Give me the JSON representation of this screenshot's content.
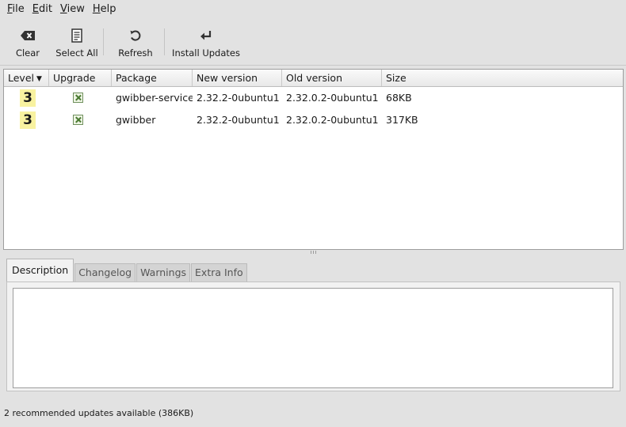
{
  "menu": [
    {
      "mnemonic": "F",
      "rest": "ile"
    },
    {
      "mnemonic": "E",
      "rest": "dit"
    },
    {
      "mnemonic": "V",
      "rest": "iew"
    },
    {
      "mnemonic": "H",
      "rest": "elp"
    }
  ],
  "toolbar": {
    "clear_label": "Clear",
    "select_all_label": "Select All",
    "refresh_label": "Refresh",
    "install_label": "Install Updates",
    "clear_icon": "backspace-icon",
    "select_all_icon": "document-list-icon",
    "refresh_icon": "refresh-icon",
    "install_icon": "enter-arrow-icon"
  },
  "table": {
    "columns": [
      "Level",
      "Upgrade",
      "Package",
      "New version",
      "Old version",
      "Size"
    ],
    "sort_indicator": "▼",
    "rows": [
      {
        "level": "3",
        "upgrade": true,
        "package": "gwibber-service",
        "new_version": "2.32.2-0ubuntu1",
        "old_version": "2.32.0.2-0ubuntu1",
        "size": "68KB"
      },
      {
        "level": "3",
        "upgrade": true,
        "package": "gwibber",
        "new_version": "2.32.2-0ubuntu1",
        "old_version": "2.32.0.2-0ubuntu1",
        "size": "317KB"
      }
    ]
  },
  "tabs": [
    "Description",
    "Changelog",
    "Warnings",
    "Extra Info"
  ],
  "active_tab": "Description",
  "status": "2 recommended updates available (386KB)",
  "colors": {
    "level_badge": "#f8f2a0",
    "checkbox_mark": "#4a7a32"
  }
}
